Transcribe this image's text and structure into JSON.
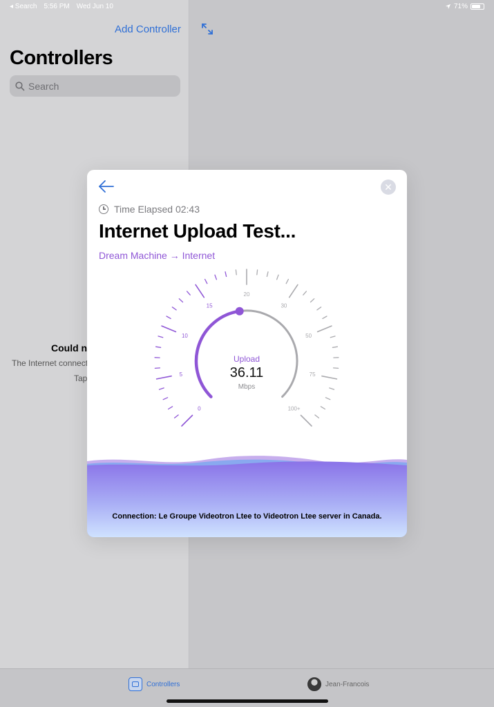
{
  "status_bar": {
    "back_app": "◂ Search",
    "time": "5:56 PM",
    "date": "Wed Jun 10",
    "battery": "71%"
  },
  "sidebar": {
    "add_controller": "Add Controller",
    "title": "Controllers",
    "search_placeholder": "Search",
    "error_title_partial": "Could no",
    "error_msg_partial": "The Internet connect",
    "error_hint_partial": "Tap"
  },
  "modal": {
    "elapsed": "Time Elapsed 02:43",
    "title": "Internet Upload Test...",
    "route_from": "Dream Machine",
    "route_arrow": "→",
    "route_to": "Internet",
    "gauge": {
      "label": "Upload",
      "value": "36.11",
      "unit": "Mbps",
      "progress_fraction": 0.47,
      "scale_labels": [
        "0",
        "5",
        "10",
        "15",
        "20",
        "30",
        "50",
        "75",
        "100+"
      ]
    },
    "connection_text": "Connection: Le Groupe Videotron Ltee to Videotron Ltee server in Canada."
  },
  "tab_bar": {
    "controllers": "Controllers",
    "user": "Jean-Francois"
  },
  "colors": {
    "accent_blue": "#2f6fd6",
    "accent_purple": "#8f56d6"
  }
}
